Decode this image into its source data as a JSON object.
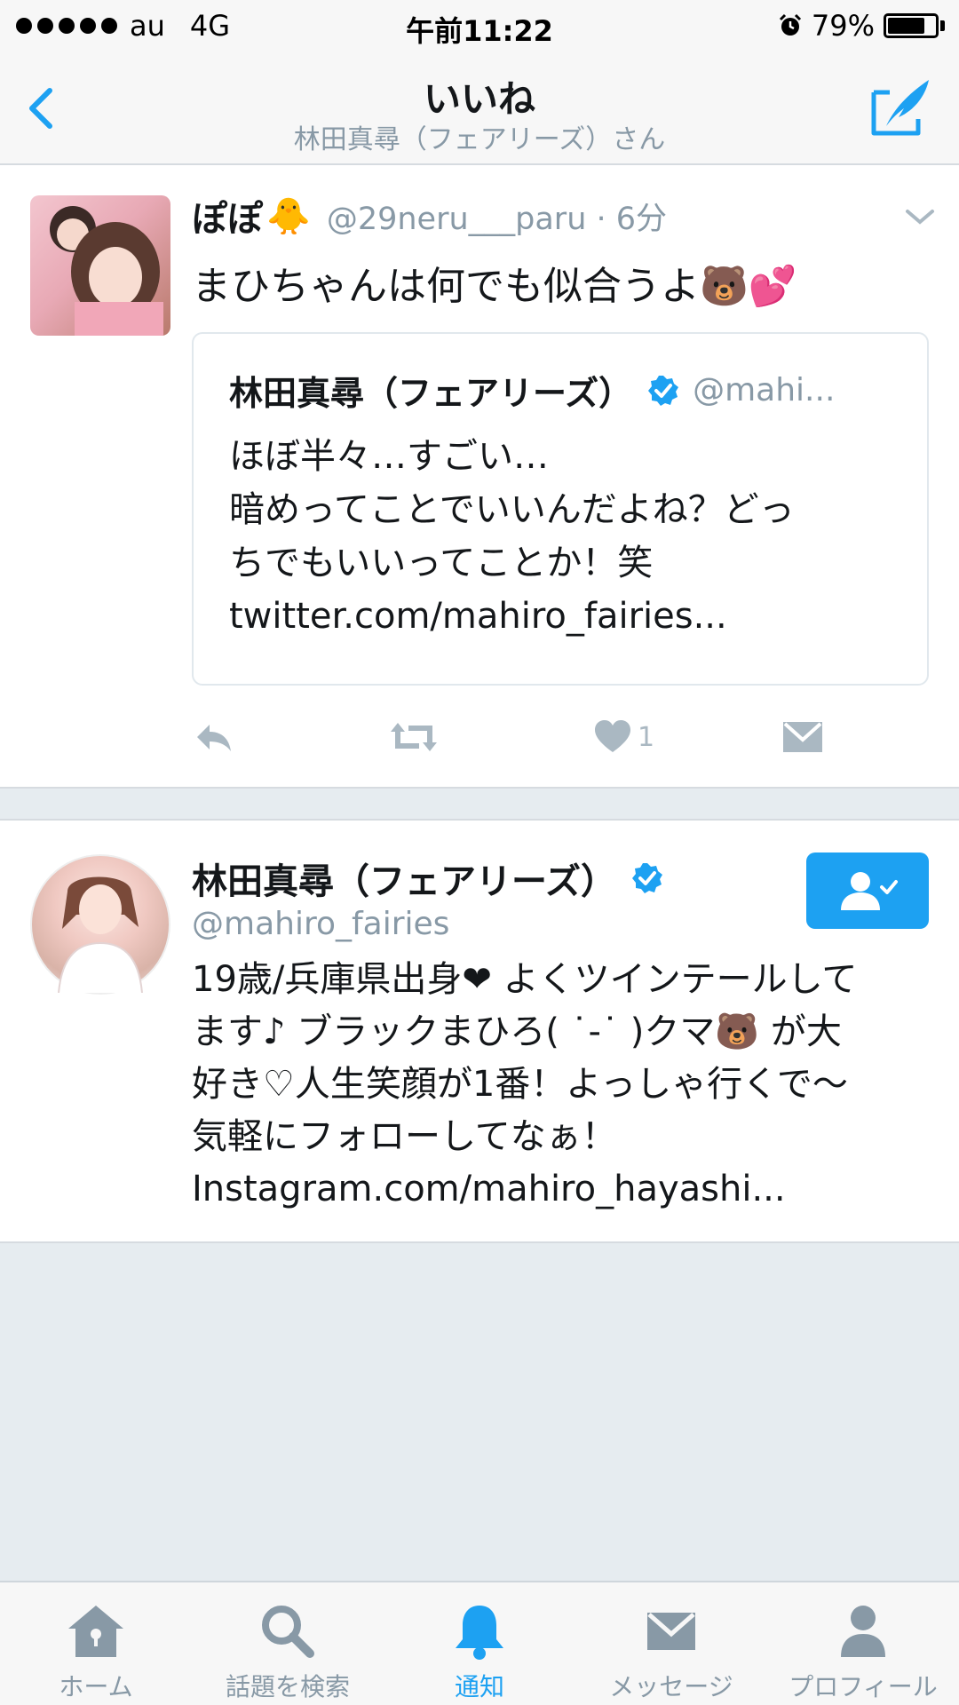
{
  "status_bar": {
    "carrier": "au",
    "network": "4G",
    "time": "午前11:22",
    "battery_percent": "79%",
    "battery_level": 0.79
  },
  "nav": {
    "title": "いいね",
    "subtitle": "林田真尋（フェアリーズ）さん",
    "back_icon": "chevron-left-icon",
    "compose_icon": "compose-tweet-icon"
  },
  "tweet": {
    "name": "ぽぽ",
    "name_emoji": "🐥",
    "handle": "@29neru___paru · 6分",
    "text": "まひちゃんは何でも似合うよ🐻💕",
    "quote": {
      "name": "林田真尋（フェアリーズ）",
      "handle": "@mahi...",
      "lines": [
        "ほぼ半々…すごい…",
        "暗めってことでいいんだよね？どっ",
        "ちでもいいってことか！笑",
        "twitter.com/mahiro_fairies..."
      ]
    },
    "actions": {
      "like_count": "1"
    }
  },
  "user": {
    "name": "林田真尋（フェアリーズ）",
    "handle": "@mahiro_fairies",
    "bio_lines": [
      "19歳/兵庫県出身❤ よくツインテールして",
      "ます♪ ブラックまひろ( ˙-˙ )クマ🐻 が大",
      "好き♡人生笑顔が1番！よっしゃ行くで〜",
      "気軽にフォローしてなぁ！",
      "Instagram.com/mahiro_hayashi..."
    ]
  },
  "tabs": [
    {
      "label": "ホーム",
      "icon": "home-icon"
    },
    {
      "label": "話題を検索",
      "icon": "search-icon"
    },
    {
      "label": "通知",
      "icon": "bell-icon"
    },
    {
      "label": "メッセージ",
      "icon": "envelope-icon"
    },
    {
      "label": "プロフィール",
      "icon": "person-icon"
    }
  ],
  "colors": {
    "accent": "#1da1f2",
    "muted": "#8899a6",
    "background": "#e6ecf0"
  }
}
